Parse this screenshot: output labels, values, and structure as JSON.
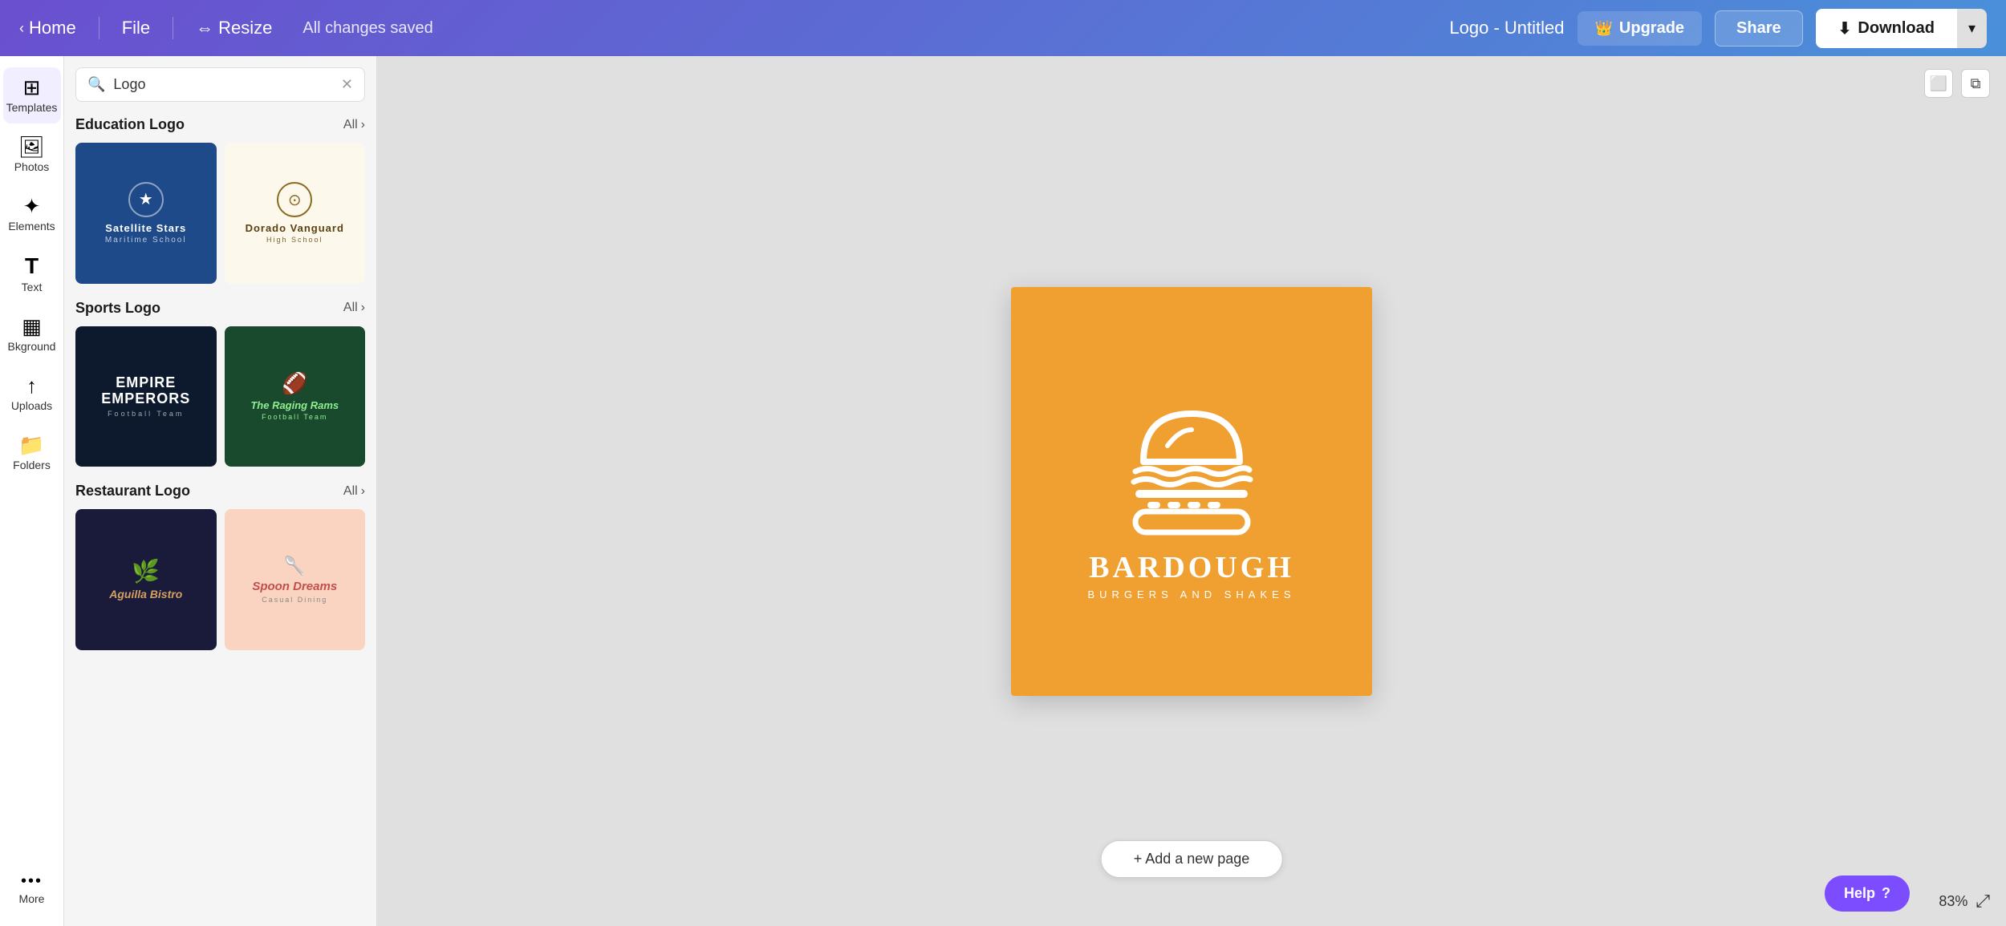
{
  "topbar": {
    "home_label": "Home",
    "file_label": "File",
    "resize_label": "Resize",
    "saved_label": "All changes saved",
    "doc_title": "Logo - Untitled",
    "upgrade_label": "Upgrade",
    "share_label": "Share",
    "download_label": "Download"
  },
  "sidebar": {
    "items": [
      {
        "id": "templates",
        "label": "Templates",
        "icon": "⊞"
      },
      {
        "id": "photos",
        "label": "Photos",
        "icon": "🖼"
      },
      {
        "id": "elements",
        "label": "Elements",
        "icon": "✦"
      },
      {
        "id": "text",
        "label": "Text",
        "icon": "T"
      },
      {
        "id": "background",
        "label": "Bkground",
        "icon": "▦"
      },
      {
        "id": "uploads",
        "label": "Uploads",
        "icon": "↑"
      },
      {
        "id": "folders",
        "label": "Folders",
        "icon": "📁"
      },
      {
        "id": "more",
        "label": "More",
        "icon": "•••"
      }
    ]
  },
  "templates_panel": {
    "search_value": "Logo",
    "search_placeholder": "Logo",
    "sections": [
      {
        "id": "education",
        "title": "Education Logo",
        "all_label": "All",
        "cards": [
          {
            "id": "satellite",
            "theme": "satellite",
            "name": "Satellite Stars",
            "sub": "Maritime School"
          },
          {
            "id": "dorado",
            "theme": "dorado",
            "name": "Dorado Vanguard",
            "sub": "High School"
          }
        ]
      },
      {
        "id": "sports",
        "title": "Sports Logo",
        "all_label": "All",
        "cards": [
          {
            "id": "empire",
            "theme": "empire",
            "name": "Empire Emperors",
            "sub": "Football Team"
          },
          {
            "id": "raging",
            "theme": "raging",
            "name": "The Raging Rams",
            "sub": "Football Team"
          }
        ]
      },
      {
        "id": "restaurant",
        "title": "Restaurant Logo",
        "all_label": "All",
        "cards": [
          {
            "id": "aguilla",
            "theme": "aguilla",
            "name": "Aguilla Bistro",
            "sub": ""
          },
          {
            "id": "spoon",
            "theme": "spoon",
            "name": "Spoon Dreams",
            "sub": "Casual Dining"
          }
        ]
      }
    ]
  },
  "canvas": {
    "brand_name": "BARDOUGH",
    "brand_sub": "BURGERS AND SHAKES",
    "add_page_label": "+ Add a new page",
    "zoom_level": "83%"
  },
  "help": {
    "label": "Help",
    "icon": "?"
  }
}
